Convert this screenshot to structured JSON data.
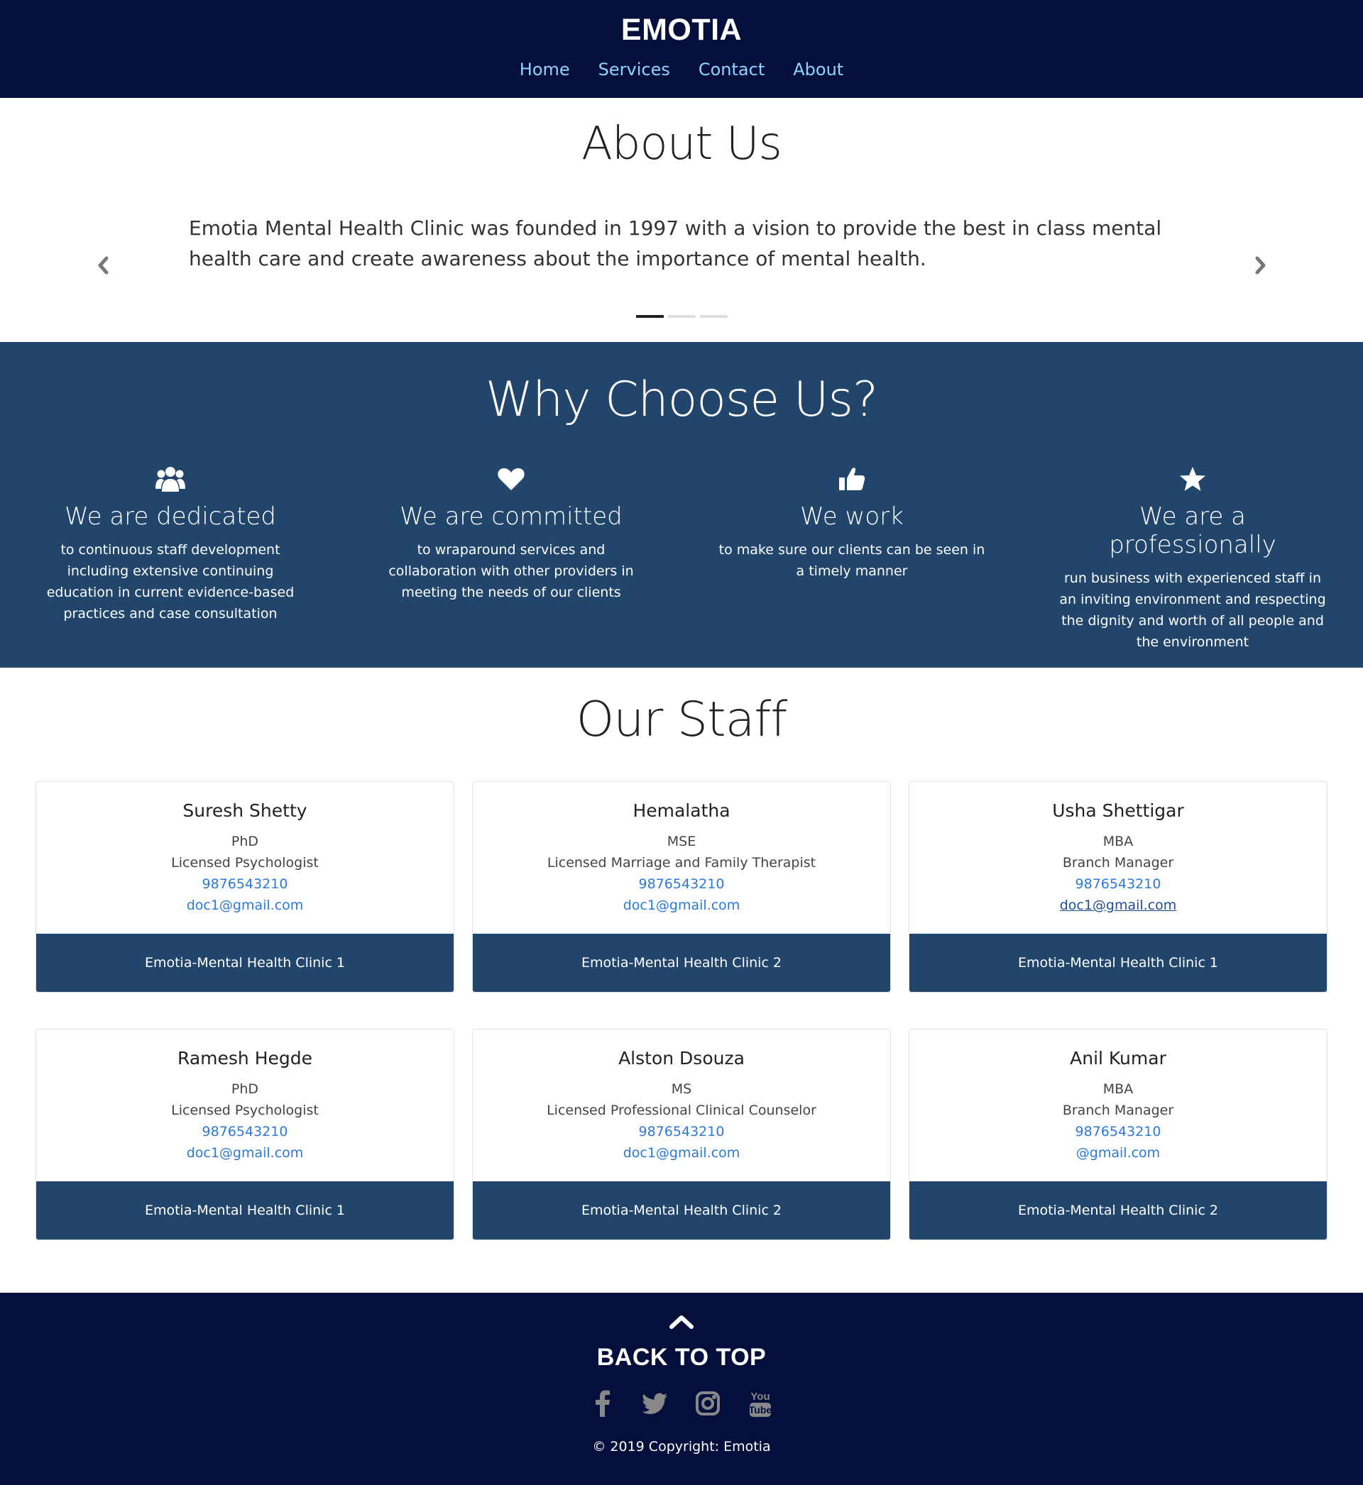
{
  "header": {
    "brand": "EMOTIA",
    "nav": [
      "Home",
      "Services",
      "Contact",
      "About"
    ]
  },
  "about": {
    "title": "About Us",
    "text": "Emotia Mental Health Clinic was founded in 1997 with a vision to provide the best in class mental health care and create awareness about the importance of mental health.",
    "prev_icon": "chevron-left-icon",
    "next_icon": "chevron-right-icon",
    "slides": 3,
    "active_slide": 1
  },
  "why": {
    "title": "Why Choose Us?",
    "features": [
      {
        "icon": "users-icon",
        "title": "We are dedicated",
        "text": "to continuous staff development including extensive continuing education in current evidence-based practices and case consultation"
      },
      {
        "icon": "heart-icon",
        "title": "We are committed",
        "text": "to wraparound services and collaboration with other providers in meeting the needs of our clients"
      },
      {
        "icon": "thumbs-up-icon",
        "title": "We work",
        "text": "to make sure our clients can be seen in a timely manner"
      },
      {
        "icon": "star-icon",
        "title": "We are a professionally",
        "text": "run business with experienced staff in an inviting environment and respecting the dignity and worth of all people and the environment"
      }
    ]
  },
  "staff": {
    "title": "Our Staff",
    "members": [
      {
        "name": "Suresh Shetty",
        "degree": "PhD",
        "role": "Licensed Psychologist",
        "phone": "9876543210",
        "email": "doc1@gmail.com",
        "clinic": "Emotia-Mental Health Clinic 1"
      },
      {
        "name": "Hemalatha",
        "degree": "MSE",
        "role": "Licensed Marriage and Family Therapist",
        "phone": "9876543210",
        "email": "doc1@gmail.com",
        "clinic": "Emotia-Mental Health Clinic 2"
      },
      {
        "name": "Usha Shettigar",
        "degree": "MBA",
        "role": "Branch Manager",
        "phone": "9876543210",
        "email": "doc1@gmail.com",
        "clinic": "Emotia-Mental Health Clinic 1"
      },
      {
        "name": "Ramesh Hegde",
        "degree": "PhD",
        "role": "Licensed Psychologist",
        "phone": "9876543210",
        "email": "doc1@gmail.com",
        "clinic": "Emotia-Mental Health Clinic 1"
      },
      {
        "name": "Alston Dsouza",
        "degree": "MS",
        "role": "Licensed Professional Clinical Counselor",
        "phone": "9876543210",
        "email": "doc1@gmail.com",
        "clinic": "Emotia-Mental Health Clinic 2"
      },
      {
        "name": "Anil Kumar",
        "degree": "MBA",
        "role": "Branch Manager",
        "phone": "9876543210",
        "email": "@gmail.com",
        "clinic": "Emotia-Mental Health Clinic 2"
      }
    ]
  },
  "footer": {
    "arrow_icon": "chevron-up-icon",
    "back_to_top": "BACK TO TOP",
    "socials": [
      "facebook-icon",
      "twitter-icon",
      "instagram-icon",
      "youtube-icon"
    ],
    "copyright": "© 2019 Copyright: Emotia"
  },
  "colors": {
    "navy": "#040f3b",
    "section_blue": "#21456b",
    "link_blue": "#2b79d8",
    "nav_link": "#8fd3ff"
  }
}
